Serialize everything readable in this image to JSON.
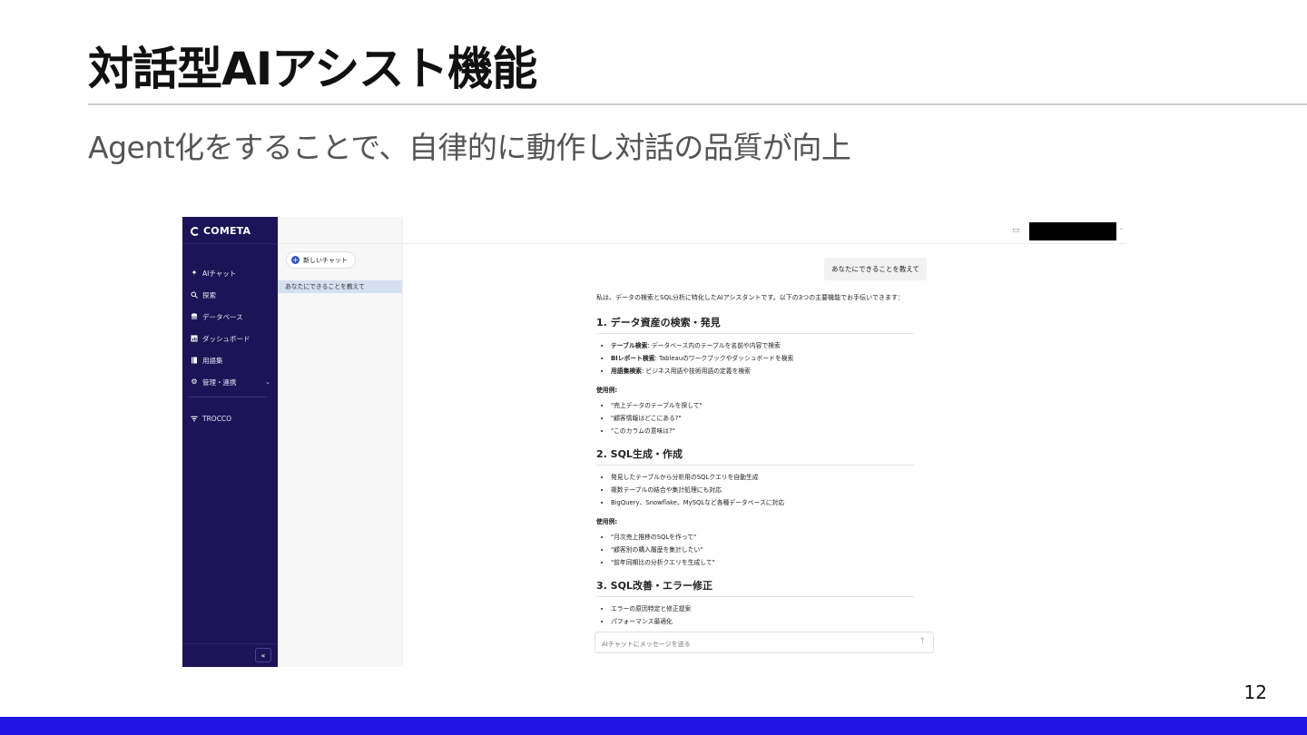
{
  "slide": {
    "title": "対話型AIアシスト機能",
    "subtitle": "Agent化をすることで、自律的に動作し対話の品質が向上",
    "page_number": "12"
  },
  "app": {
    "brand": "COMETA",
    "nav": [
      {
        "icon": "sparkle-icon",
        "label": "AIチャット"
      },
      {
        "icon": "search-icon",
        "label": "探索"
      },
      {
        "icon": "database-icon",
        "label": "データベース"
      },
      {
        "icon": "dashboard-icon",
        "label": "ダッシュボード"
      },
      {
        "icon": "glossary-icon",
        "label": "用語集"
      },
      {
        "icon": "gear-icon",
        "label": "管理・連携"
      }
    ],
    "trocco_label": "TROCCO",
    "collapse_symbol": "«",
    "new_chat_label": "新しいチャット",
    "history": [
      "あなたにできることを教えて"
    ],
    "user_message": "あなたにできることを教えて",
    "answer": {
      "intro": "私は、データの検索とSQL分析に特化したAIアシスタントです。以下の3つの主要機能でお手伝いできます：",
      "sections": [
        {
          "heading": "1. データ資産の検索・発見",
          "items": [
            {
              "bold": "テーブル検索",
              "text": ": データベース内のテーブルを名前や内容で検索"
            },
            {
              "bold": "BIレポート検索",
              "text": ": Tableauのワークブックやダッシュボードを検索"
            },
            {
              "bold": "用語集検索",
              "text": ": ビジネス用語や技術用語の定義を検索"
            }
          ],
          "usage_label": "使用例:",
          "examples": [
            "\"売上データのテーブルを探して\"",
            "\"顧客情報はどこにある?\"",
            "\"このカラムの意味は?\""
          ]
        },
        {
          "heading": "2. SQL生成・作成",
          "items": [
            {
              "bold": "",
              "text": "発見したテーブルから分析用のSQLクエリを自動生成"
            },
            {
              "bold": "",
              "text": "複数テーブルの結合や集計処理にも対応"
            },
            {
              "bold": "",
              "text": "BigQuery、Snowflake、MySQLなど各種データベースに対応"
            }
          ],
          "usage_label": "使用例:",
          "examples": [
            "\"月次売上推移のSQLを作って\"",
            "\"顧客別の購入履歴を集計したい\"",
            "\"前年同期比の分析クエリを生成して\""
          ]
        },
        {
          "heading": "3. SQL改善・エラー修正",
          "items": [
            {
              "bold": "",
              "text": "エラーの原因特定と修正提案"
            },
            {
              "bold": "",
              "text": "パフォーマンス最適化"
            }
          ]
        }
      ]
    },
    "input_placeholder": "AIチャットにメッセージを送る"
  },
  "colors": {
    "sidebar": "#1c1456",
    "accent_bar": "#2117e3",
    "history_selected": "#d4e0ef",
    "new_chat_icon": "#2f56c9"
  }
}
